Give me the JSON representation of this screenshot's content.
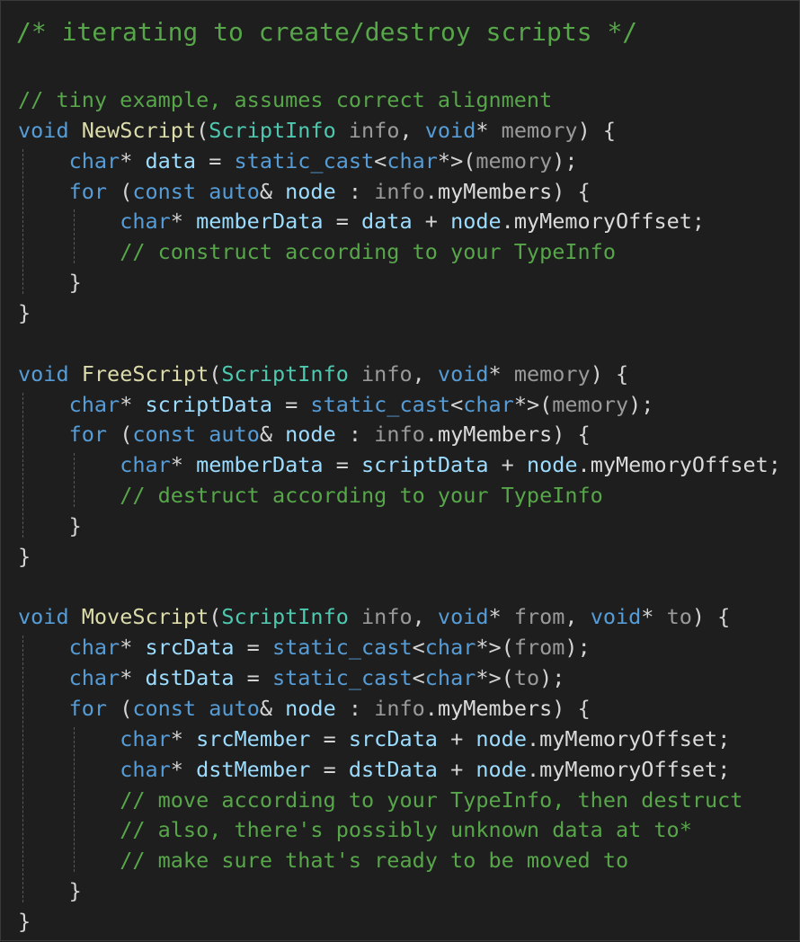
{
  "editor": {
    "theme": {
      "background": "#1e1e1e",
      "comment": "#57a64a",
      "keyword": "#569cd6",
      "type": "#4ec9b0",
      "function": "#dcdcaa",
      "parameter": "#9a9a9a",
      "variable": "#9cdcfe",
      "text": "#d4d4d4"
    },
    "lines": [
      {
        "kind": "title",
        "tokens": [
          {
            "t": "/* iterating to create/destroy scripts */",
            "c": "comment"
          }
        ]
      },
      {
        "kind": "blank",
        "tokens": []
      },
      {
        "tokens": [
          {
            "t": "// tiny example, assumes correct alignment",
            "c": "comment"
          }
        ]
      },
      {
        "tokens": [
          {
            "t": "void",
            "c": "keyword"
          },
          {
            "t": " ",
            "c": "plain"
          },
          {
            "t": "NewScript",
            "c": "func"
          },
          {
            "t": "(",
            "c": "punct"
          },
          {
            "t": "ScriptInfo",
            "c": "type"
          },
          {
            "t": " ",
            "c": "plain"
          },
          {
            "t": "info",
            "c": "param"
          },
          {
            "t": ", ",
            "c": "punct"
          },
          {
            "t": "void",
            "c": "keyword"
          },
          {
            "t": "* ",
            "c": "punct"
          },
          {
            "t": "memory",
            "c": "param"
          },
          {
            "t": ") {",
            "c": "punct"
          }
        ]
      },
      {
        "tokens": [
          {
            "t": "    ",
            "c": "plain"
          },
          {
            "t": "char",
            "c": "keyword"
          },
          {
            "t": "* ",
            "c": "punct"
          },
          {
            "t": "data",
            "c": "var"
          },
          {
            "t": " = ",
            "c": "punct"
          },
          {
            "t": "static_cast",
            "c": "keyword"
          },
          {
            "t": "<",
            "c": "punct"
          },
          {
            "t": "char",
            "c": "keyword"
          },
          {
            "t": "*>(",
            "c": "punct"
          },
          {
            "t": "memory",
            "c": "param"
          },
          {
            "t": ");",
            "c": "punct"
          }
        ]
      },
      {
        "tokens": [
          {
            "t": "    ",
            "c": "plain"
          },
          {
            "t": "for",
            "c": "keyword2"
          },
          {
            "t": " (",
            "c": "punct"
          },
          {
            "t": "const",
            "c": "keyword"
          },
          {
            "t": " ",
            "c": "plain"
          },
          {
            "t": "auto",
            "c": "keyword"
          },
          {
            "t": "& ",
            "c": "punct"
          },
          {
            "t": "node",
            "c": "var"
          },
          {
            "t": " : ",
            "c": "punct"
          },
          {
            "t": "info",
            "c": "param"
          },
          {
            "t": ".",
            "c": "punct"
          },
          {
            "t": "myMembers",
            "c": "member"
          },
          {
            "t": ") {",
            "c": "punct"
          }
        ]
      },
      {
        "tokens": [
          {
            "t": "        ",
            "c": "plain"
          },
          {
            "t": "char",
            "c": "keyword"
          },
          {
            "t": "* ",
            "c": "punct"
          },
          {
            "t": "memberData",
            "c": "var"
          },
          {
            "t": " = ",
            "c": "punct"
          },
          {
            "t": "data",
            "c": "var"
          },
          {
            "t": " + ",
            "c": "punct"
          },
          {
            "t": "node",
            "c": "var"
          },
          {
            "t": ".",
            "c": "punct"
          },
          {
            "t": "myMemoryOffset",
            "c": "member"
          },
          {
            "t": ";",
            "c": "punct"
          }
        ]
      },
      {
        "tokens": [
          {
            "t": "        ",
            "c": "plain"
          },
          {
            "t": "// construct according to your TypeInfo",
            "c": "comment"
          }
        ]
      },
      {
        "tokens": [
          {
            "t": "    ",
            "c": "plain"
          },
          {
            "t": "}",
            "c": "punct"
          }
        ]
      },
      {
        "tokens": [
          {
            "t": "}",
            "c": "punct"
          }
        ]
      },
      {
        "kind": "blank",
        "tokens": []
      },
      {
        "tokens": [
          {
            "t": "void",
            "c": "keyword"
          },
          {
            "t": " ",
            "c": "plain"
          },
          {
            "t": "FreeScript",
            "c": "func"
          },
          {
            "t": "(",
            "c": "punct"
          },
          {
            "t": "ScriptInfo",
            "c": "type"
          },
          {
            "t": " ",
            "c": "plain"
          },
          {
            "t": "info",
            "c": "param"
          },
          {
            "t": ", ",
            "c": "punct"
          },
          {
            "t": "void",
            "c": "keyword"
          },
          {
            "t": "* ",
            "c": "punct"
          },
          {
            "t": "memory",
            "c": "param"
          },
          {
            "t": ") {",
            "c": "punct"
          }
        ]
      },
      {
        "tokens": [
          {
            "t": "    ",
            "c": "plain"
          },
          {
            "t": "char",
            "c": "keyword"
          },
          {
            "t": "* ",
            "c": "punct"
          },
          {
            "t": "scriptData",
            "c": "var"
          },
          {
            "t": " = ",
            "c": "punct"
          },
          {
            "t": "static_cast",
            "c": "keyword"
          },
          {
            "t": "<",
            "c": "punct"
          },
          {
            "t": "char",
            "c": "keyword"
          },
          {
            "t": "*>(",
            "c": "punct"
          },
          {
            "t": "memory",
            "c": "param"
          },
          {
            "t": ");",
            "c": "punct"
          }
        ]
      },
      {
        "tokens": [
          {
            "t": "    ",
            "c": "plain"
          },
          {
            "t": "for",
            "c": "keyword2"
          },
          {
            "t": " (",
            "c": "punct"
          },
          {
            "t": "const",
            "c": "keyword"
          },
          {
            "t": " ",
            "c": "plain"
          },
          {
            "t": "auto",
            "c": "keyword"
          },
          {
            "t": "& ",
            "c": "punct"
          },
          {
            "t": "node",
            "c": "var"
          },
          {
            "t": " : ",
            "c": "punct"
          },
          {
            "t": "info",
            "c": "param"
          },
          {
            "t": ".",
            "c": "punct"
          },
          {
            "t": "myMembers",
            "c": "member"
          },
          {
            "t": ") {",
            "c": "punct"
          }
        ]
      },
      {
        "tokens": [
          {
            "t": "        ",
            "c": "plain"
          },
          {
            "t": "char",
            "c": "keyword"
          },
          {
            "t": "* ",
            "c": "punct"
          },
          {
            "t": "memberData",
            "c": "var"
          },
          {
            "t": " = ",
            "c": "punct"
          },
          {
            "t": "scriptData",
            "c": "var"
          },
          {
            "t": " + ",
            "c": "punct"
          },
          {
            "t": "node",
            "c": "var"
          },
          {
            "t": ".",
            "c": "punct"
          },
          {
            "t": "myMemoryOffset",
            "c": "member"
          },
          {
            "t": ";",
            "c": "punct"
          }
        ]
      },
      {
        "tokens": [
          {
            "t": "        ",
            "c": "plain"
          },
          {
            "t": "// destruct according to your TypeInfo",
            "c": "comment"
          }
        ]
      },
      {
        "tokens": [
          {
            "t": "    ",
            "c": "plain"
          },
          {
            "t": "}",
            "c": "punct"
          }
        ]
      },
      {
        "tokens": [
          {
            "t": "}",
            "c": "punct"
          }
        ]
      },
      {
        "kind": "blank",
        "tokens": []
      },
      {
        "tokens": [
          {
            "t": "void",
            "c": "keyword"
          },
          {
            "t": " ",
            "c": "plain"
          },
          {
            "t": "MoveScript",
            "c": "func"
          },
          {
            "t": "(",
            "c": "punct"
          },
          {
            "t": "ScriptInfo",
            "c": "type"
          },
          {
            "t": " ",
            "c": "plain"
          },
          {
            "t": "info",
            "c": "param"
          },
          {
            "t": ", ",
            "c": "punct"
          },
          {
            "t": "void",
            "c": "keyword"
          },
          {
            "t": "* ",
            "c": "punct"
          },
          {
            "t": "from",
            "c": "param"
          },
          {
            "t": ", ",
            "c": "punct"
          },
          {
            "t": "void",
            "c": "keyword"
          },
          {
            "t": "* ",
            "c": "punct"
          },
          {
            "t": "to",
            "c": "param"
          },
          {
            "t": ") {",
            "c": "punct"
          }
        ]
      },
      {
        "tokens": [
          {
            "t": "    ",
            "c": "plain"
          },
          {
            "t": "char",
            "c": "keyword"
          },
          {
            "t": "* ",
            "c": "punct"
          },
          {
            "t": "srcData",
            "c": "var"
          },
          {
            "t": " = ",
            "c": "punct"
          },
          {
            "t": "static_cast",
            "c": "keyword"
          },
          {
            "t": "<",
            "c": "punct"
          },
          {
            "t": "char",
            "c": "keyword"
          },
          {
            "t": "*>(",
            "c": "punct"
          },
          {
            "t": "from",
            "c": "param"
          },
          {
            "t": ");",
            "c": "punct"
          }
        ]
      },
      {
        "tokens": [
          {
            "t": "    ",
            "c": "plain"
          },
          {
            "t": "char",
            "c": "keyword"
          },
          {
            "t": "* ",
            "c": "punct"
          },
          {
            "t": "dstData",
            "c": "var"
          },
          {
            "t": " = ",
            "c": "punct"
          },
          {
            "t": "static_cast",
            "c": "keyword"
          },
          {
            "t": "<",
            "c": "punct"
          },
          {
            "t": "char",
            "c": "keyword"
          },
          {
            "t": "*>(",
            "c": "punct"
          },
          {
            "t": "to",
            "c": "param"
          },
          {
            "t": ");",
            "c": "punct"
          }
        ]
      },
      {
        "tokens": [
          {
            "t": "    ",
            "c": "plain"
          },
          {
            "t": "for",
            "c": "keyword2"
          },
          {
            "t": " (",
            "c": "punct"
          },
          {
            "t": "const",
            "c": "keyword"
          },
          {
            "t": " ",
            "c": "plain"
          },
          {
            "t": "auto",
            "c": "keyword"
          },
          {
            "t": "& ",
            "c": "punct"
          },
          {
            "t": "node",
            "c": "var"
          },
          {
            "t": " : ",
            "c": "punct"
          },
          {
            "t": "info",
            "c": "param"
          },
          {
            "t": ".",
            "c": "punct"
          },
          {
            "t": "myMembers",
            "c": "member"
          },
          {
            "t": ") {",
            "c": "punct"
          }
        ]
      },
      {
        "tokens": [
          {
            "t": "        ",
            "c": "plain"
          },
          {
            "t": "char",
            "c": "keyword"
          },
          {
            "t": "* ",
            "c": "punct"
          },
          {
            "t": "srcMember",
            "c": "var"
          },
          {
            "t": " = ",
            "c": "punct"
          },
          {
            "t": "srcData",
            "c": "var"
          },
          {
            "t": " + ",
            "c": "punct"
          },
          {
            "t": "node",
            "c": "var"
          },
          {
            "t": ".",
            "c": "punct"
          },
          {
            "t": "myMemoryOffset",
            "c": "member"
          },
          {
            "t": ";",
            "c": "punct"
          }
        ]
      },
      {
        "tokens": [
          {
            "t": "        ",
            "c": "plain"
          },
          {
            "t": "char",
            "c": "keyword"
          },
          {
            "t": "* ",
            "c": "punct"
          },
          {
            "t": "dstMember",
            "c": "var"
          },
          {
            "t": " = ",
            "c": "punct"
          },
          {
            "t": "dstData",
            "c": "var"
          },
          {
            "t": " + ",
            "c": "punct"
          },
          {
            "t": "node",
            "c": "var"
          },
          {
            "t": ".",
            "c": "punct"
          },
          {
            "t": "myMemoryOffset",
            "c": "member"
          },
          {
            "t": ";",
            "c": "punct"
          }
        ]
      },
      {
        "tokens": [
          {
            "t": "        ",
            "c": "plain"
          },
          {
            "t": "// move according to your TypeInfo, then destruct",
            "c": "comment"
          }
        ]
      },
      {
        "tokens": [
          {
            "t": "        ",
            "c": "plain"
          },
          {
            "t": "// also, there's possibly unknown data at to*",
            "c": "comment"
          }
        ]
      },
      {
        "tokens": [
          {
            "t": "        ",
            "c": "plain"
          },
          {
            "t": "// make sure that's ready to be moved to",
            "c": "comment"
          }
        ]
      },
      {
        "tokens": [
          {
            "t": "    ",
            "c": "plain"
          },
          {
            "t": "}",
            "c": "punct"
          }
        ]
      },
      {
        "tokens": [
          {
            "t": "}",
            "c": "punct"
          }
        ]
      }
    ]
  }
}
